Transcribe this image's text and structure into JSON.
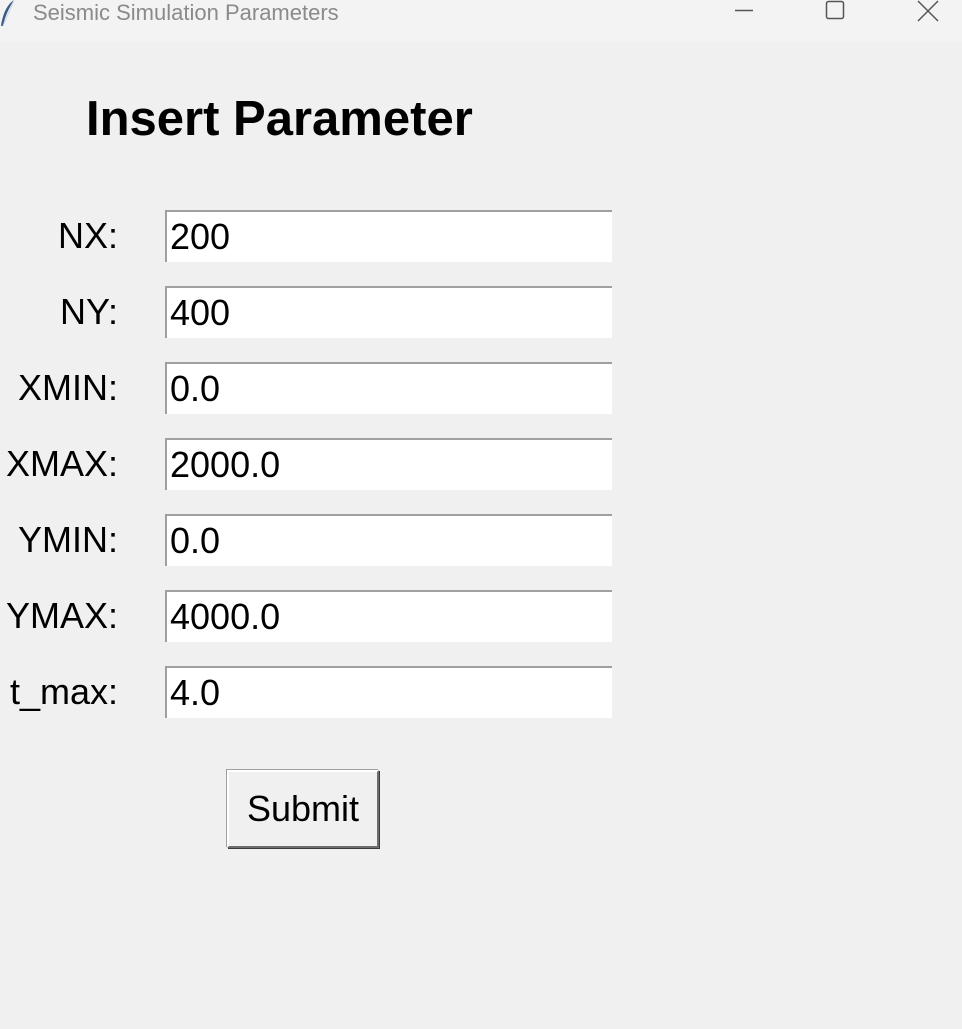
{
  "window": {
    "title": "Seismic Simulation Parameters",
    "icon": "feather-icon",
    "controls": [
      "minimize-icon",
      "maximize-icon",
      "close-icon"
    ]
  },
  "form": {
    "heading": "Insert Parameter",
    "fields": [
      {
        "label": "NX:",
        "value": "200"
      },
      {
        "label": "NY:",
        "value": "400"
      },
      {
        "label": "XMIN:",
        "value": "0.0"
      },
      {
        "label": "XMAX:",
        "value": "2000.0"
      },
      {
        "label": "YMIN:",
        "value": "0.0"
      },
      {
        "label": "YMAX:",
        "value": "4000.0"
      },
      {
        "label": "t_max:",
        "value": "4.0"
      }
    ],
    "submit_label": "Submit"
  }
}
